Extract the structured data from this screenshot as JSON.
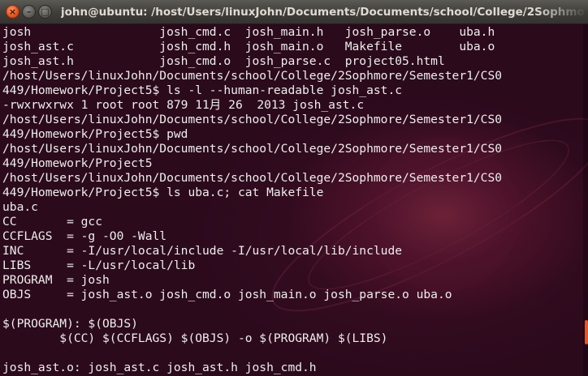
{
  "window": {
    "title": "john@ubuntu: /host/Users/linuxJohn/Documents/Documents/school/College/2Sophmo"
  },
  "terminal": {
    "lines": [
      "josh                  josh_cmd.c  josh_main.h   josh_parse.o    uba.h",
      "josh_ast.c            josh_cmd.h  josh_main.o   Makefile        uba.o",
      "josh_ast.h            josh_cmd.o  josh_parse.c  project05.html",
      "/host/Users/linuxJohn/Documents/school/College/2Sophmore/Semester1/CS0",
      "449/Homework/Project5$ ls -l --human-readable josh_ast.c",
      "-rwxrwxrwx 1 root root 879 11月 26  2013 josh_ast.c",
      "/host/Users/linuxJohn/Documents/school/College/2Sophmore/Semester1/CS0",
      "449/Homework/Project5$ pwd",
      "/host/Users/linuxJohn/Documents/school/College/2Sophmore/Semester1/CS0",
      "449/Homework/Project5",
      "/host/Users/linuxJohn/Documents/school/College/2Sophmore/Semester1/CS0",
      "449/Homework/Project5$ ls uba.c; cat Makefile",
      "uba.c",
      "CC       = gcc",
      "CCFLAGS  = -g -O0 -Wall",
      "INC      = -I/usr/local/include -I/usr/local/lib/include",
      "LIBS     = -L/usr/local/lib",
      "PROGRAM  = josh",
      "OBJS     = josh_ast.o josh_cmd.o josh_main.o josh_parse.o uba.o",
      "",
      "$(PROGRAM): $(OBJS)",
      "        $(CC) $(CCFLAGS) $(OBJS) -o $(PROGRAM) $(LIBS)",
      "",
      "josh_ast.o: josh_ast.c josh_ast.h josh_cmd.h"
    ]
  },
  "colors": {
    "background": "#2b0a1c",
    "text": "#eeeeec",
    "accent": "#e95420",
    "titlebar": "#3e3d39"
  },
  "icons": {
    "close": "close-icon",
    "minimize": "minimize-icon",
    "maximize": "maximize-icon"
  }
}
